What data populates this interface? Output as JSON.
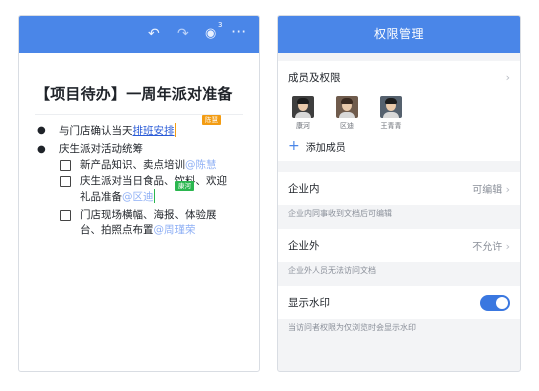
{
  "editor": {
    "toolbar": {
      "undo": "↶",
      "redo": "↷",
      "viewer_count": "3",
      "more": "···"
    },
    "title": "【项目待办】一周年派对准备",
    "items": [
      {
        "prefix": "与门店确认当天",
        "link": "排班安排",
        "collaborator_tag": "陈慧"
      },
      {
        "text": "庆生派对活动统筹"
      }
    ],
    "todos": [
      {
        "text": "新产品知识、卖点培训",
        "mention": "@陈慧"
      },
      {
        "line1": "庆生派对当日食品、饮料、欢迎",
        "line2": "礼品准备",
        "mention": "@区迪",
        "collaborator_tag": "康河"
      },
      {
        "line1": "门店现场横幅、海报、体验展",
        "line2": "台、拍照点布置",
        "mention": "@周瑾荣"
      }
    ],
    "colors": {
      "header": "#4a86e8",
      "link": "#2a5bd7",
      "tag_orange": "#f39c12",
      "tag_green": "#2bb64f"
    }
  },
  "permissions": {
    "header_title": "权限管理",
    "members_label": "成员及权限",
    "members": [
      {
        "name": "康河"
      },
      {
        "name": "区迪"
      },
      {
        "name": "王青青"
      }
    ],
    "add_member": "添加成员",
    "internal": {
      "label": "企业内",
      "value": "可编辑",
      "desc": "企业内同事收到文档后可编辑"
    },
    "external": {
      "label": "企业外",
      "value": "不允许",
      "desc": "企业外人员无法访问文档"
    },
    "watermark": {
      "label": "显示水印",
      "enabled": true,
      "desc": "当访问者权限为仅浏览时会显示水印"
    }
  }
}
